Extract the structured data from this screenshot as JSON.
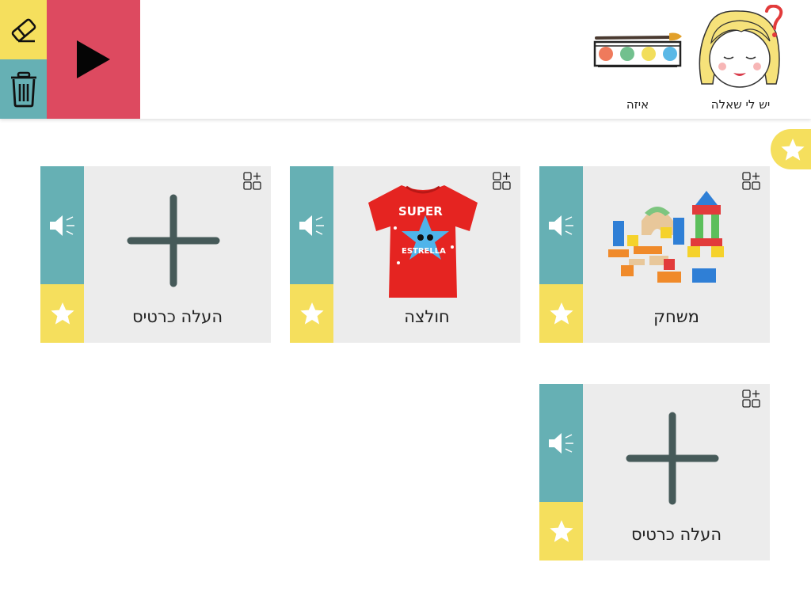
{
  "header": {
    "question_label": "יש לי שאלה",
    "which_label": "איזה"
  },
  "cards": [
    {
      "label": "משחק",
      "picture": "toy-blocks-image"
    },
    {
      "label": "חולצה",
      "picture": "red-tshirt-image",
      "shirt_text_1": "SUPER",
      "shirt_text_2": "ESTRELLA"
    },
    {
      "label": "העלה כרטיס",
      "picture": "plus-icon"
    },
    {
      "label": "העלה כרטיס",
      "picture": "plus-icon"
    }
  ],
  "colors": {
    "yellow": "#f5df5d",
    "teal": "#66b0b4",
    "red": "#dd4a60",
    "card_bg": "#ececec",
    "plus": "#465a59"
  }
}
